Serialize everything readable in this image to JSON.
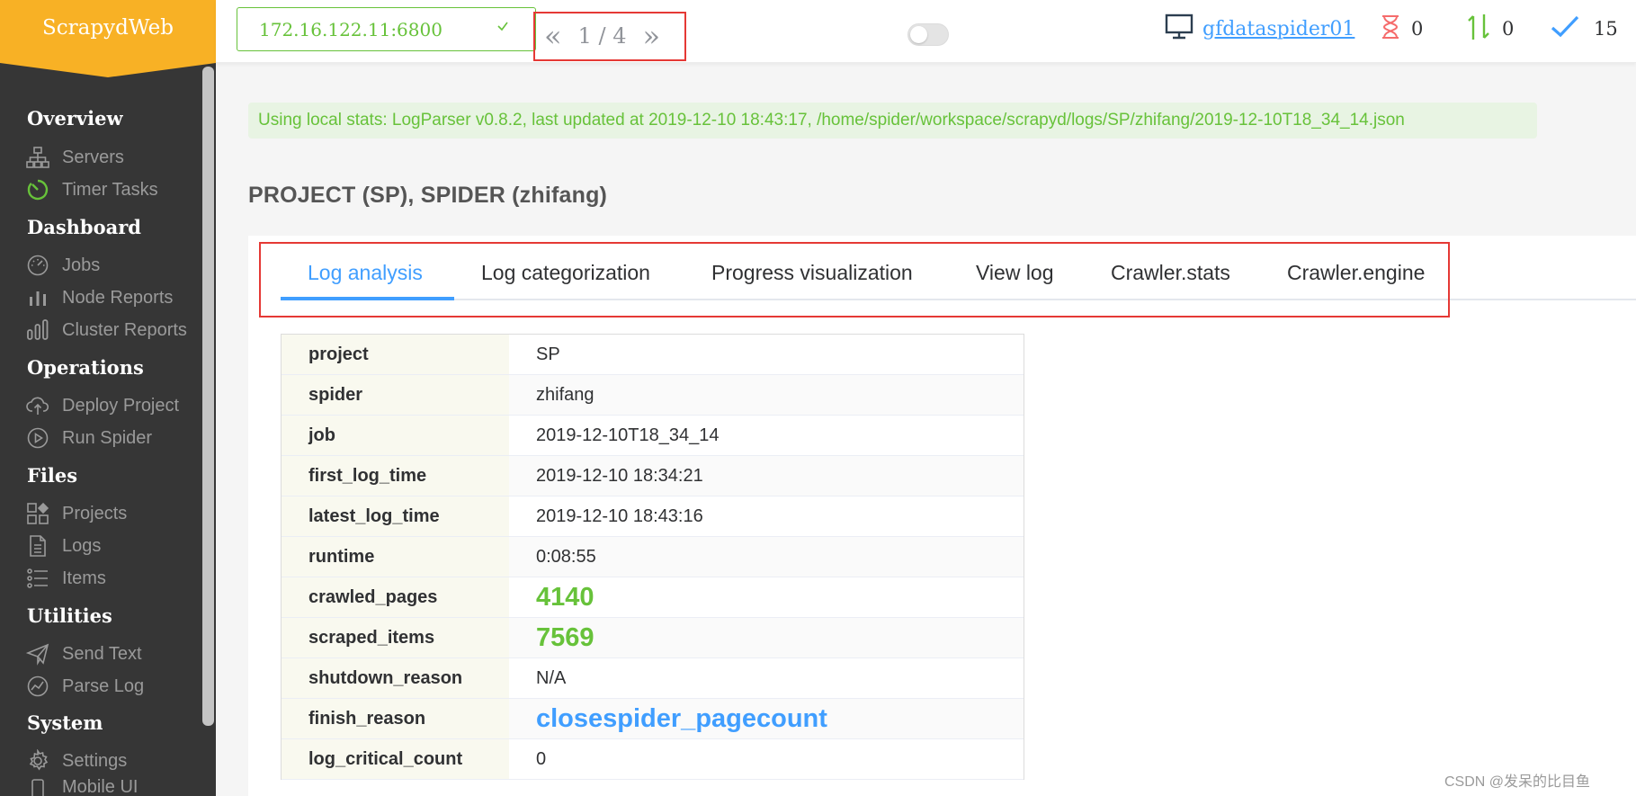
{
  "app": {
    "logo": "ScrapydWeb"
  },
  "sidebar": {
    "sections": [
      {
        "title": "Overview",
        "items": [
          {
            "label": "Servers",
            "icon": "sitemap-icon"
          },
          {
            "label": "Timer Tasks",
            "icon": "timer-icon"
          }
        ]
      },
      {
        "title": "Dashboard",
        "items": [
          {
            "label": "Jobs",
            "icon": "dashboard-gauge-icon"
          },
          {
            "label": "Node Reports",
            "icon": "bar-chart-icon"
          },
          {
            "label": "Cluster Reports",
            "icon": "bars-icon"
          }
        ]
      },
      {
        "title": "Operations",
        "items": [
          {
            "label": "Deploy Project",
            "icon": "cloud-upload-icon"
          },
          {
            "label": "Run Spider",
            "icon": "play-circle-icon"
          }
        ]
      },
      {
        "title": "Files",
        "items": [
          {
            "label": "Projects",
            "icon": "grid-icon"
          },
          {
            "label": "Logs",
            "icon": "document-icon"
          },
          {
            "label": "Items",
            "icon": "list-icon"
          }
        ]
      },
      {
        "title": "Utilities",
        "items": [
          {
            "label": "Send Text",
            "icon": "paper-plane-icon"
          },
          {
            "label": "Parse Log",
            "icon": "chart-circle-icon"
          }
        ]
      },
      {
        "title": "System",
        "items": [
          {
            "label": "Settings",
            "icon": "gear-icon"
          },
          {
            "label": "Mobile UI",
            "icon": "mobile-icon"
          }
        ]
      }
    ]
  },
  "header": {
    "server": "172.16.122.11:6800",
    "pager": {
      "prev": "«",
      "current": "1",
      "sep": "/",
      "total": "4",
      "next": "»"
    },
    "node_name": "gfdataspider01",
    "pending_count": "0",
    "running_count": "0",
    "finished_count": "15",
    "colors": {
      "pending": "#f56c6c",
      "running": "#67c23a",
      "finished": "#409eff"
    }
  },
  "notice": "Using local stats: LogParser v0.8.2, last updated at 2019-12-10 18:43:17, /home/spider/workspace/scrapyd/logs/SP/zhifang/2019-12-10T18_34_14.json",
  "page_title": "PROJECT (SP), SPIDER (zhifang)",
  "tabs": [
    "Log analysis",
    "Log categorization",
    "Progress visualization",
    "View log",
    "Crawler.stats",
    "Crawler.engine"
  ],
  "table": {
    "rows": [
      {
        "key": "project",
        "value": "SP"
      },
      {
        "key": "spider",
        "value": "zhifang"
      },
      {
        "key": "job",
        "value": "2019-12-10T18_34_14"
      },
      {
        "key": "first_log_time",
        "value": "2019-12-10 18:34:21"
      },
      {
        "key": "latest_log_time",
        "value": "2019-12-10 18:43:16"
      },
      {
        "key": "runtime",
        "value": "0:08:55"
      },
      {
        "key": "crawled_pages",
        "value": "4140"
      },
      {
        "key": "scraped_items",
        "value": "7569"
      },
      {
        "key": "shutdown_reason",
        "value": "N/A"
      },
      {
        "key": "finish_reason",
        "value": "closespider_pagecount"
      },
      {
        "key": "log_critical_count",
        "value": "0"
      }
    ]
  },
  "watermark": "CSDN @发呆的比目鱼"
}
